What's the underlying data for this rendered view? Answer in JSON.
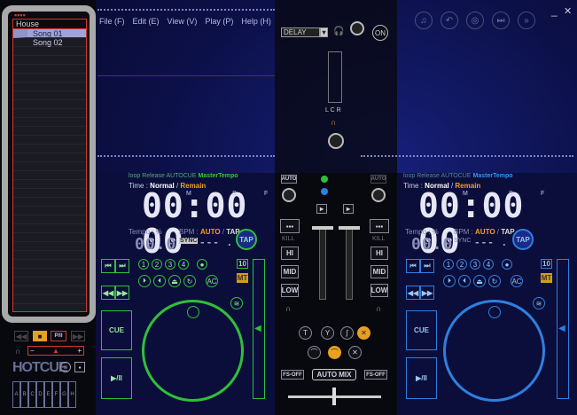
{
  "menu": [
    "File (F)",
    "Edit (E)",
    "View (V)",
    "Play (P)",
    "Help (H)"
  ],
  "window": {
    "minimize": "_",
    "close": "✕"
  },
  "playlist": {
    "folder": "House",
    "songs": [
      "Song 01",
      "Song 02"
    ]
  },
  "effects": {
    "selected": "DELAY",
    "on_label": "ON",
    "lcr": "L C R"
  },
  "decks": [
    {
      "status": [
        "loop",
        "Release",
        "AUTOCUE",
        "MasterTempo"
      ],
      "time_label": "Time :",
      "time_normal": "Normal",
      "time_remain": "Remain",
      "time": "00:00 00",
      "m": "M",
      "s": "S",
      "f": "F",
      "tempo_label": "Tempo : %",
      "tempo": "00.0",
      "bpm_label": "BPM :",
      "bpm_auto": "AUTO",
      "bpm_tap": "TAP",
      "sync": "SYNC",
      "bpm": "--- . -",
      "tap": "TAP",
      "hotcues": [
        "1",
        "2",
        "3",
        "4",
        "●"
      ],
      "pitch_range": "10",
      "mt": "MT",
      "cue": "CUE",
      "play": "▶/II",
      "ac": "AC",
      "accent": "#2fbf3a"
    },
    {
      "status": [
        "loop",
        "Release",
        "AUTOCUE",
        "MasterTempo"
      ],
      "time_label": "Time :",
      "time_normal": "Normal",
      "time_remain": "Remain",
      "time": "00:00 00",
      "m": "M",
      "s": "S",
      "f": "F",
      "tempo_label": "Tempo : %",
      "tempo": "00.0",
      "bpm_label": "BPM :",
      "bpm_auto": "AUTO",
      "bpm_tap": "TAP",
      "sync": "SYNC",
      "bpm": "--- . -",
      "tap": "TAP",
      "hotcues": [
        "1",
        "2",
        "3",
        "4",
        "●"
      ],
      "pitch_range": "10",
      "mt": "MT",
      "cue": "CUE",
      "play": "▶/II",
      "ac": "AC",
      "accent": "#2f7fe0"
    }
  ],
  "mixer": {
    "auto": "AUTO",
    "kill": "KILL",
    "hi": "HI",
    "mid": "MID",
    "low": "LOW",
    "fs_off": "FS-OFF",
    "auto_mix": "AUTO MIX"
  },
  "sampler": {
    "hotcue": "HOTCUE",
    "keys": [
      "A",
      "B",
      "C",
      "D",
      "E",
      "F",
      "G",
      "H"
    ],
    "play": "P/II"
  }
}
